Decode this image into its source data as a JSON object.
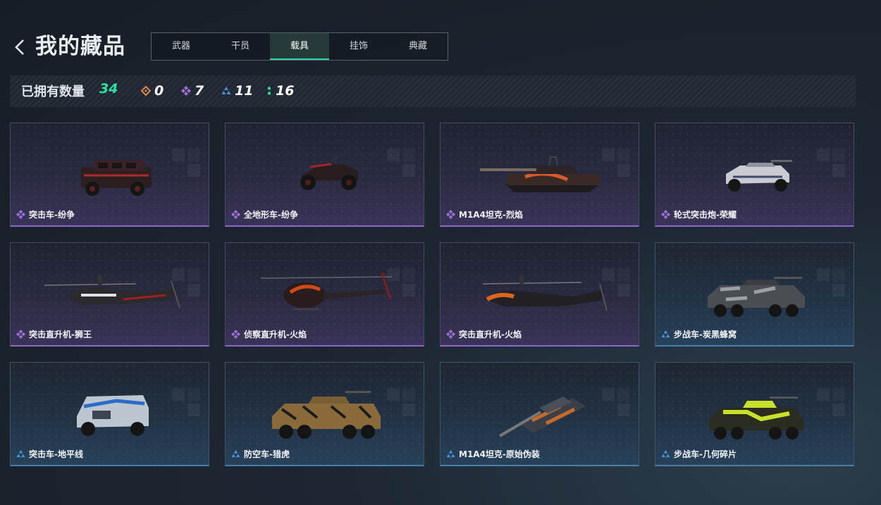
{
  "header": {
    "title": "我的藏品",
    "tabs": [
      {
        "label": "武器",
        "active": false
      },
      {
        "label": "干员",
        "active": false
      },
      {
        "label": "载具",
        "active": true
      },
      {
        "label": "挂饰",
        "active": false
      },
      {
        "label": "典藏",
        "active": false
      }
    ]
  },
  "stats": {
    "label": "已拥有数量",
    "total": "34",
    "rarities": [
      {
        "icon": "orange-diamond-icon",
        "color": "#d98a4a",
        "count": "0"
      },
      {
        "icon": "purple-diamond-icon",
        "color": "#9b6fd6",
        "count": "7"
      },
      {
        "icon": "blue-triangle-icon",
        "color": "#4a90d9",
        "count": "11"
      },
      {
        "icon": "green-dots-icon",
        "color": "#2fd6a0",
        "count": "16"
      }
    ]
  },
  "colors": {
    "accent": "#30d6a0",
    "purple": "#8a67c8",
    "blue": "#4a7ea8"
  },
  "cards": [
    {
      "name": "突击车-纷争",
      "rarity": "purple",
      "icon": "purple-diamond-icon",
      "vehicle": "assault-vehicle-image"
    },
    {
      "name": "全地形车-纷争",
      "rarity": "purple",
      "icon": "purple-diamond-icon",
      "vehicle": "atv-image"
    },
    {
      "name": "M1A4坦克-烈焰",
      "rarity": "purple",
      "icon": "purple-diamond-icon",
      "vehicle": "tank-image"
    },
    {
      "name": "轮式突击炮-荣耀",
      "rarity": "purple",
      "icon": "purple-diamond-icon",
      "vehicle": "wheeled-gun-image"
    },
    {
      "name": "突击直升机-狮王",
      "rarity": "purple",
      "icon": "purple-diamond-icon",
      "vehicle": "attack-helicopter-image"
    },
    {
      "name": "侦察直升机-火焰",
      "rarity": "purple",
      "icon": "purple-diamond-icon",
      "vehicle": "scout-helicopter-image"
    },
    {
      "name": "突击直升机-火焰",
      "rarity": "purple",
      "icon": "purple-diamond-icon",
      "vehicle": "attack-helicopter-image"
    },
    {
      "name": "步战车-炭黑蜂窝",
      "rarity": "blue",
      "icon": "blue-triangle-icon",
      "vehicle": "ifv-image"
    },
    {
      "name": "突击车-地平线",
      "rarity": "blue",
      "icon": "blue-triangle-icon",
      "vehicle": "assault-vehicle-image"
    },
    {
      "name": "防空车-猎虎",
      "rarity": "blue",
      "icon": "blue-triangle-icon",
      "vehicle": "aa-vehicle-image"
    },
    {
      "name": "M1A4坦克-原始伪装",
      "rarity": "blue",
      "icon": "blue-triangle-icon",
      "vehicle": "tank-image"
    },
    {
      "name": "步战车-几何碎片",
      "rarity": "blue",
      "icon": "blue-triangle-icon",
      "vehicle": "ifv-image"
    }
  ]
}
